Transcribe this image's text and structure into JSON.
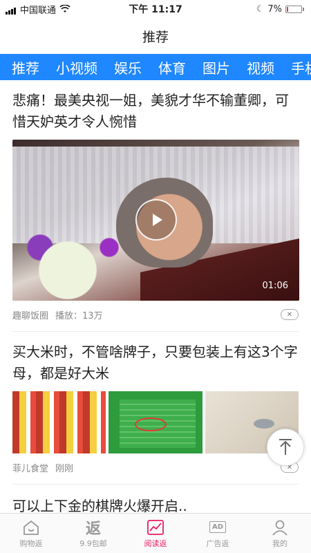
{
  "status_bar": {
    "carrier": "中国联通",
    "time": "下午 11:17",
    "battery": "7%"
  },
  "header": {
    "title": "推荐"
  },
  "tabs": [
    {
      "label": "推荐",
      "active": true
    },
    {
      "label": "小视频"
    },
    {
      "label": "娱乐"
    },
    {
      "label": "体育"
    },
    {
      "label": "图片"
    },
    {
      "label": "视频"
    },
    {
      "label": "手机"
    }
  ],
  "feed": [
    {
      "headline": "悲痛！最美央视一姐，美貌才华不输董卿，可惜天妒英才令人惋惜",
      "duration": "01:06",
      "source": "趣聊饭圈",
      "plays": "播放：13万"
    },
    {
      "headline": "买大米时，不管啥牌子，只要包装上有这3个字母，都是好大米",
      "source": "菲儿食堂",
      "time": "刚刚"
    },
    {
      "headline": "可以上下金的棋牌火爆开启.."
    }
  ],
  "bottom_nav": [
    {
      "label": "购物返",
      "icon": "home-icon"
    },
    {
      "label": "9.9包邮",
      "icon": "fan-icon",
      "glyph": "返"
    },
    {
      "label": "阅读返",
      "icon": "chart-icon",
      "active": true
    },
    {
      "label": "广告返",
      "icon": "ad-icon",
      "glyph": "AD"
    },
    {
      "label": "我的",
      "icon": "user-icon"
    }
  ],
  "colors": {
    "tab_bar": "#1f87ff",
    "active_nav": "#e91e63"
  }
}
